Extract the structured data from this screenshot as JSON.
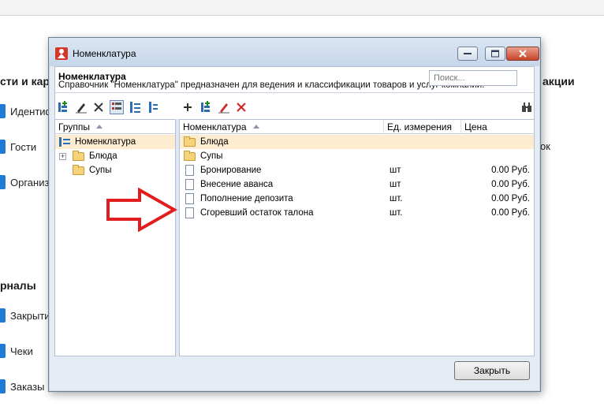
{
  "background": {
    "sections": [
      "сти и кар",
      "рналы"
    ],
    "right_section": "акции",
    "right_item": "ок",
    "items": [
      "Идентиф",
      "Гости",
      "Организ",
      "Закрыти",
      "Чеки",
      "Заказы"
    ]
  },
  "dialog": {
    "title": "Номенклатура",
    "info_title": "Номенклатура",
    "info_desc": "Справочник \"Номенклатура\" предназначен для ведения и классификации товаров и услуг компании.",
    "search_placeholder": "Поиск...",
    "groups_header": "Группы",
    "tree": [
      {
        "label": "Номенклатура",
        "selected": true
      },
      {
        "label": "Блюда"
      },
      {
        "label": "Супы"
      }
    ],
    "columns": [
      "Номенклатура",
      "Ед. измерения",
      "Цена"
    ],
    "rows": [
      {
        "name": "Блюда",
        "unit": "",
        "price": "",
        "kind": "folder"
      },
      {
        "name": "Супы",
        "unit": "",
        "price": "",
        "kind": "folder"
      },
      {
        "name": "Бронирование",
        "unit": "шт",
        "price": "0.00 Руб.",
        "kind": "doc"
      },
      {
        "name": "Внесение аванса",
        "unit": "шт",
        "price": "0.00 Руб.",
        "kind": "doc"
      },
      {
        "name": "Пополнение депозита",
        "unit": "шт.",
        "price": "0.00 Руб.",
        "kind": "doc"
      },
      {
        "name": "Сгоревший остаток талона",
        "unit": "шт.",
        "price": "0.00 Руб.",
        "kind": "doc"
      }
    ],
    "close_label": "Закрыть"
  },
  "colors": {
    "accent": "#1f7bd6",
    "selection": "#fdecd0",
    "arrow": "#e11d1d",
    "close_button": "#c8442a"
  }
}
